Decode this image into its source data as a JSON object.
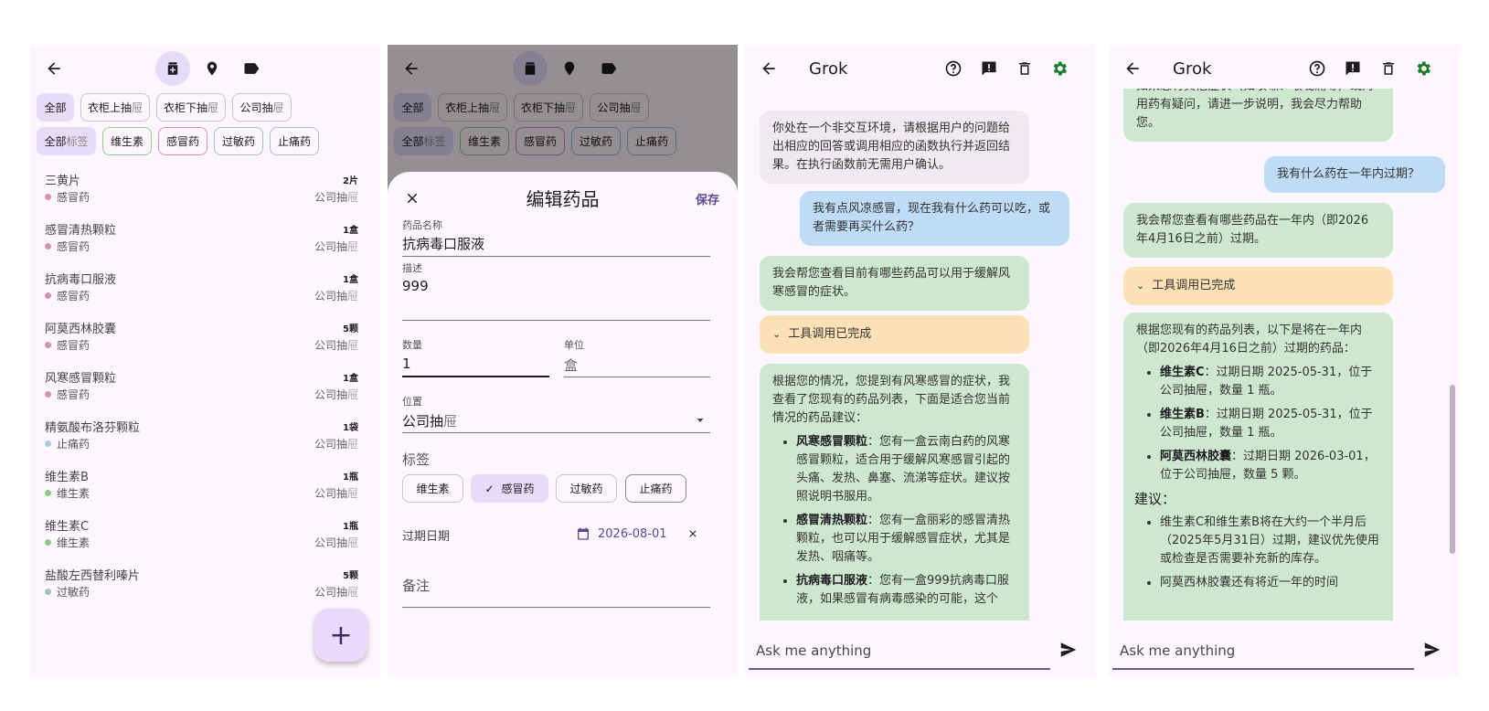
{
  "panel1": {
    "nav": {
      "back_icon": "arrow-left-icon",
      "tab_icons": [
        "medicine-icon",
        "location-pin-icon",
        "label-tag-icon"
      ]
    },
    "location_filters": [
      {
        "label": "全部",
        "suffix": "",
        "selected": true
      },
      {
        "label": "衣柜上抽",
        "suffix": "屉",
        "selected": false
      },
      {
        "label": "衣柜下抽",
        "suffix": "屉",
        "selected": false
      },
      {
        "label": "公司抽",
        "suffix": "屉",
        "selected": false
      }
    ],
    "tag_filters": [
      {
        "label": "全部",
        "suffix": "标签",
        "selected": true,
        "color": "#e5dcf7"
      },
      {
        "label": "维生素",
        "suffix": "",
        "selected": false,
        "color": "#8fce8a"
      },
      {
        "label": "感冒药",
        "suffix": "",
        "selected": false,
        "color": "#d98fb6"
      },
      {
        "label": "过敏药",
        "suffix": "",
        "selected": false,
        "color": "#9fc2c8"
      },
      {
        "label": "止痛药",
        "suffix": "",
        "selected": false,
        "color": "#a7c3dc"
      }
    ],
    "medicines": [
      {
        "name": "三黄片",
        "qty": "2片",
        "tag": "感冒药",
        "tag_color": "#d391b4",
        "loc": "公司抽",
        "loc_suffix": "屉"
      },
      {
        "name": "感冒清热颗粒",
        "qty": "1盒",
        "tag": "感冒药",
        "tag_color": "#d391b4",
        "loc": "公司抽",
        "loc_suffix": "屉"
      },
      {
        "name": "抗病毒口服液",
        "qty": "1盒",
        "tag": "感冒药",
        "tag_color": "#d391b4",
        "loc": "公司抽",
        "loc_suffix": "屉"
      },
      {
        "name": "阿莫西林胶囊",
        "qty": "5颗",
        "tag": "感冒药",
        "tag_color": "#d391b4",
        "loc": "公司抽",
        "loc_suffix": "屉"
      },
      {
        "name": "风寒感冒颗粒",
        "qty": "1盒",
        "tag": "感冒药",
        "tag_color": "#d391b4",
        "loc": "公司抽",
        "loc_suffix": "屉"
      },
      {
        "name": "精氨酸布洛芬颗粒",
        "qty": "1袋",
        "tag": "止痛药",
        "tag_color": "#a9c8e8",
        "loc": "公司抽",
        "loc_suffix": "屉"
      },
      {
        "name": "维生素B",
        "qty": "1瓶",
        "tag": "维生素",
        "tag_color": "#8ccc86",
        "loc": "公司抽",
        "loc_suffix": "屉"
      },
      {
        "name": "维生素C",
        "qty": "1瓶",
        "tag": "维生素",
        "tag_color": "#8ccc86",
        "loc": "公司抽",
        "loc_suffix": "屉"
      },
      {
        "name": "盐酸左西替利嗪片",
        "qty": "5颗",
        "tag": "过敏药",
        "tag_color": "#a4c0c6",
        "loc": "公司抽",
        "loc_suffix": "屉"
      }
    ],
    "fab_label": "+"
  },
  "panel2": {
    "sheet": {
      "close_icon": "close-icon",
      "title": "编辑药品",
      "save_label": "保存",
      "name_label": "药品名称",
      "name_value": "抗病毒口服液",
      "desc_label": "描述",
      "desc_value": "999",
      "qty_label": "数量",
      "qty_value": "1",
      "unit_label": "单位",
      "unit_value": "盒",
      "location_label": "位置",
      "location_value": "公司抽",
      "location_suffix": "屉",
      "tags_label": "标签",
      "tags": [
        {
          "label": "维生素",
          "selected": false
        },
        {
          "label": "感冒药",
          "selected": true
        },
        {
          "label": "过敏药",
          "selected": false
        },
        {
          "label": "止痛药",
          "selected": false
        }
      ],
      "expiry_label": "过期日期",
      "expiry_value": "2026-08-01",
      "notes_label": "备注"
    }
  },
  "panel3": {
    "title": "Grok",
    "icons": [
      "help-circle-icon",
      "feedback-icon",
      "delete-icon",
      "settings-icon"
    ],
    "settings_color": "#1a7e2a",
    "messages": {
      "system": "你处在一个非交互环境，请根据用户的问题给出相应的回答或调用相应的函数执行并返回结果。在执行函数前无需用户确认。",
      "user": "我有点风凉感冒，现在我有什么药可以吃，或者需要再买什么药？",
      "bot1": "我会帮您查看目前有哪些药品可以用于缓解风寒感冒的症状。",
      "tool": "工具调用已完成",
      "bot2_intro": "根据您的情况，您提到有风寒感冒的症状，我查看了您现有的药品列表，下面是适合您当前情况的药品建议：",
      "bot2_items": [
        {
          "bold": "风寒感冒颗粒",
          "text": "：您有一盒云南白药的风寒感冒颗粒，适合用于缓解风寒感冒引起的头痛、发热、鼻塞、流涕等症状。建议按照说明书服用。"
        },
        {
          "bold": "感冒清热颗粒",
          "text": "：您有一盒丽彩的感冒清热颗粒，也可以用于缓解感冒症状，尤其是发热、咽痛等。"
        },
        {
          "bold": "抗病毒口服液",
          "text": "：您有一盒999抗病毒口服液，如果感冒有病毒感染的可能，这个"
        }
      ]
    },
    "input_placeholder": "Ask me anything"
  },
  "panel4": {
    "title": "Grok",
    "messages": {
      "bot0": "如果您有其他症状（如咳嗽、喉咙痛等）或对用药有疑问，请进一步说明，我会尽力帮助您。",
      "user": "我有什么药在一年内过期？",
      "bot1": "我会帮您查看有哪些药品在一年内（即2026年4月16日之前）过期。",
      "tool": "工具调用已完成",
      "bot2_intro": "根据您现有的药品列表，以下是将在一年内（即2026年4月16日之前）过期的药品：",
      "bot2_items": [
        {
          "bold": "维生素C",
          "text": "：过期日期 2025-05-31，位于公司抽屉，数量 1 瓶。"
        },
        {
          "bold": "维生素B",
          "text": "：过期日期 2025-05-31，位于公司抽屉，数量 1 瓶。"
        },
        {
          "bold": "阿莫西林胶囊",
          "text": "：过期日期 2026-03-01，位于公司抽屉，数量 5 颗。"
        }
      ],
      "advice_title": "建议：",
      "advice_items": [
        "维生素C和维生素B将在大约一个半月后（2025年5月31日）过期，建议优先使用或检查是否需要补充新的库存。",
        "阿莫西林胶囊还有将近一年的时间"
      ]
    },
    "input_placeholder": "Ask me anything"
  }
}
